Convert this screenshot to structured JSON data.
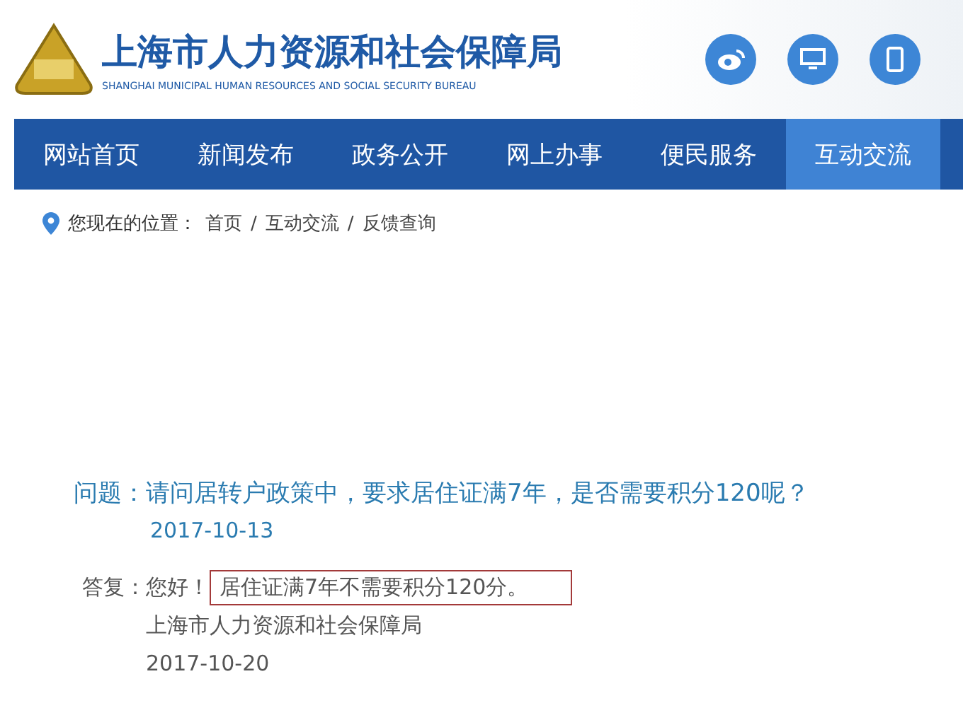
{
  "header": {
    "title": "上海市人力资源和社会保障局",
    "subtitle": "SHANGHAI MUNICIPAL HUMAN RESOURCES AND SOCIAL SECURITY BUREAU"
  },
  "nav": [
    {
      "label": "网站首页",
      "selected": false
    },
    {
      "label": "新闻发布",
      "selected": false
    },
    {
      "label": "政务公开",
      "selected": false
    },
    {
      "label": "网上办事",
      "selected": false
    },
    {
      "label": "便民服务",
      "selected": false
    },
    {
      "label": "互动交流",
      "selected": true
    }
  ],
  "breadcrumb": {
    "label": "您现在的位置：",
    "items": [
      "首页",
      "互动交流",
      "反馈查询"
    ],
    "separator": "/"
  },
  "question": {
    "label": "问题：",
    "text": "请问居转户政策中，要求居住证满7年，是否需要积分120呢？",
    "date": "2017-10-13"
  },
  "answer": {
    "label": "答复：",
    "greeting": "您好！",
    "text": "居住证满7年不需要积分120分。",
    "highlighted": true,
    "signature": "上海市人力资源和社会保障局",
    "date": "2017-10-20"
  }
}
